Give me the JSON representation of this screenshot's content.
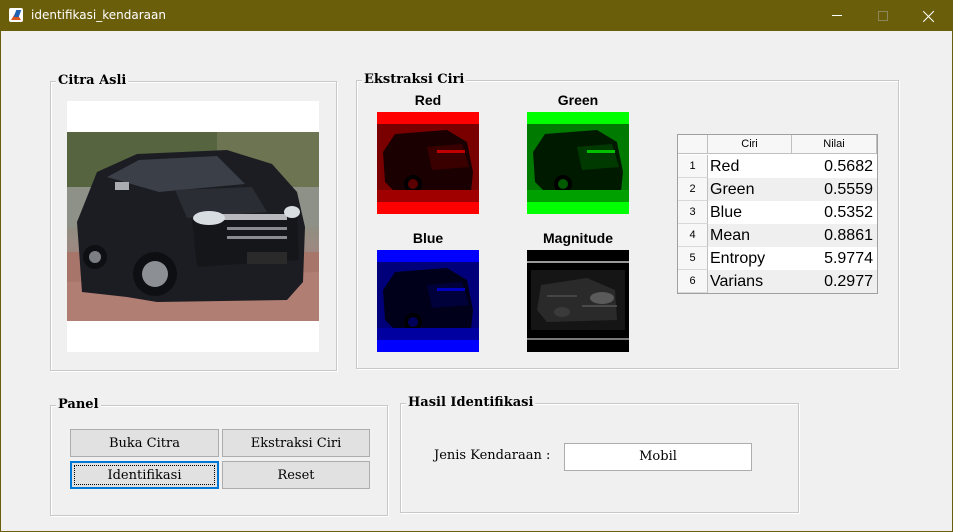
{
  "window": {
    "title": "identifikasi_kendaraan",
    "accent": "#6b5e0a"
  },
  "citra_asli": {
    "title": "Citra Asli",
    "image": "car-photo"
  },
  "ekstraksi": {
    "title": "Ekstraksi Ciri",
    "channels": [
      {
        "label": "Red",
        "color": "#ff0000"
      },
      {
        "label": "Green",
        "color": "#00ff00"
      },
      {
        "label": "Blue",
        "color": "#0000ff"
      },
      {
        "label": "Magnitude",
        "color": "#000000"
      }
    ],
    "table": {
      "headers": [
        "Ciri",
        "Nilai"
      ],
      "rows": [
        {
          "index": "1",
          "name": "Red",
          "value": "0.5682"
        },
        {
          "index": "2",
          "name": "Green",
          "value": "0.5559"
        },
        {
          "index": "3",
          "name": "Blue",
          "value": "0.5352"
        },
        {
          "index": "4",
          "name": "Mean",
          "value": "0.8861"
        },
        {
          "index": "5",
          "name": "Entropy",
          "value": "5.9774"
        },
        {
          "index": "6",
          "name": "Varians",
          "value": "0.2977"
        }
      ]
    }
  },
  "panel": {
    "title": "Panel",
    "buttons": {
      "buka": "Buka Citra",
      "ekstraksi": "Ekstraksi Ciri",
      "identifikasi": "Identifikasi",
      "reset": "Reset"
    }
  },
  "hasil": {
    "title": "Hasil Identifikasi",
    "label": "Jenis Kendaraan :",
    "value": "Mobil"
  }
}
